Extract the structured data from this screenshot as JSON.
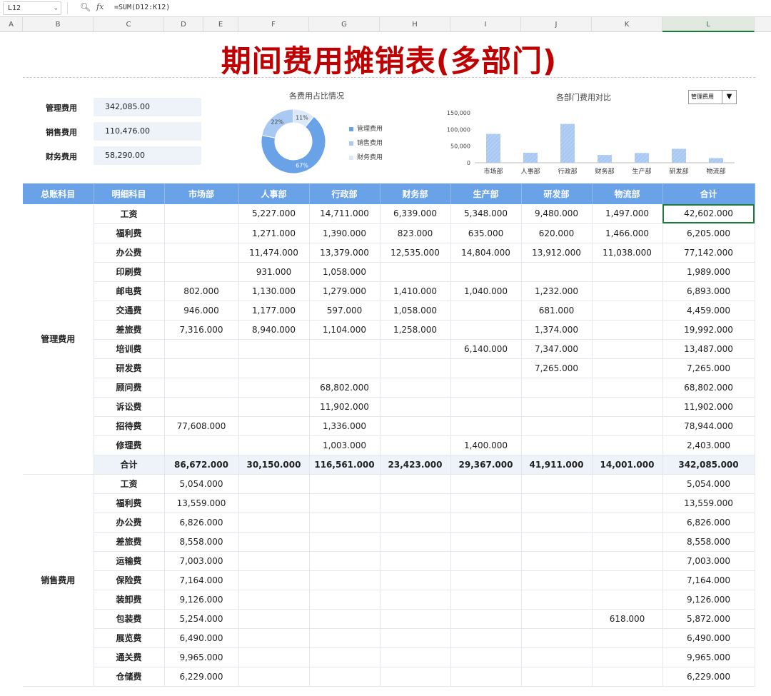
{
  "formula_bar": {
    "cell_ref": "L12",
    "formula": "=SUM(D12:K12)"
  },
  "columns": [
    "A",
    "B",
    "C",
    "D",
    "E",
    "F",
    "G",
    "H",
    "I",
    "J",
    "K",
    "L"
  ],
  "title": "期间费用摊销表(多部门)",
  "summary": [
    {
      "label": "管理费用",
      "value": "342,085.00"
    },
    {
      "label": "销售费用",
      "value": "110,476.00"
    },
    {
      "label": "财务费用",
      "value": "58,290.00"
    }
  ],
  "pie": {
    "title": "各费用占比情况",
    "slices": [
      {
        "name": "管理费用",
        "value": 67,
        "label": "67%",
        "color": "#6aa2e8"
      },
      {
        "name": "销售费用",
        "value": 22,
        "label": "22%",
        "color": "#a9c9f2"
      },
      {
        "name": "财务费用",
        "value": 11,
        "label": "11%",
        "color": "#dbe8f9"
      }
    ]
  },
  "chart_data": {
    "type": "bar",
    "title": "各部门费用对比",
    "categories": [
      "市场部",
      "人事部",
      "行政部",
      "财务部",
      "生产部",
      "研发部",
      "物流部"
    ],
    "values": [
      86672,
      30150,
      116561,
      23423,
      29367,
      41911,
      14001
    ],
    "yticks": [
      "0",
      "50,000",
      "100,000",
      "150,000"
    ],
    "ylim": [
      0,
      150000
    ],
    "color": "#a9c9f2",
    "selector": "管理费用"
  },
  "table": {
    "headers": [
      "总账科目",
      "明细科目",
      "市场部",
      "人事部",
      "行政部",
      "财务部",
      "生产部",
      "研发部",
      "物流部",
      "合计"
    ],
    "groups": [
      {
        "category": "管理费用",
        "rows": [
          [
            "工资",
            "",
            "5,227.000",
            "14,711.000",
            "6,339.000",
            "5,348.000",
            "9,480.000",
            "1,497.000",
            "42,602.000"
          ],
          [
            "福利费",
            "",
            "1,271.000",
            "1,390.000",
            "823.000",
            "635.000",
            "620.000",
            "1,466.000",
            "6,205.000"
          ],
          [
            "办公费",
            "",
            "11,474.000",
            "13,379.000",
            "12,535.000",
            "14,804.000",
            "13,912.000",
            "11,038.000",
            "77,142.000"
          ],
          [
            "印刷费",
            "",
            "931.000",
            "1,058.000",
            "",
            "",
            "",
            "",
            "1,989.000"
          ],
          [
            "邮电费",
            "802.000",
            "1,130.000",
            "1,279.000",
            "1,410.000",
            "1,040.000",
            "1,232.000",
            "",
            "6,893.000"
          ],
          [
            "交通费",
            "946.000",
            "1,177.000",
            "597.000",
            "1,058.000",
            "",
            "681.000",
            "",
            "4,459.000"
          ],
          [
            "差旅费",
            "7,316.000",
            "8,940.000",
            "1,104.000",
            "1,258.000",
            "",
            "1,374.000",
            "",
            "19,992.000"
          ],
          [
            "培训费",
            "",
            "",
            "",
            "",
            "6,140.000",
            "7,347.000",
            "",
            "13,487.000"
          ],
          [
            "研发费",
            "",
            "",
            "",
            "",
            "",
            "7,265.000",
            "",
            "7,265.000"
          ],
          [
            "顾问费",
            "",
            "",
            "68,802.000",
            "",
            "",
            "",
            "",
            "68,802.000"
          ],
          [
            "诉讼费",
            "",
            "",
            "11,902.000",
            "",
            "",
            "",
            "",
            "11,902.000"
          ],
          [
            "招待费",
            "77,608.000",
            "",
            "1,336.000",
            "",
            "",
            "",
            "",
            "78,944.000"
          ],
          [
            "修理费",
            "",
            "",
            "1,003.000",
            "",
            "1,400.000",
            "",
            "",
            "2,403.000"
          ]
        ],
        "subtotal": [
          "合计",
          "86,672.000",
          "30,150.000",
          "116,561.000",
          "23,423.000",
          "29,367.000",
          "41,911.000",
          "14,001.000",
          "342,085.000"
        ]
      },
      {
        "category": "销售费用",
        "rows": [
          [
            "工资",
            "5,054.000",
            "",
            "",
            "",
            "",
            "",
            "",
            "5,054.000"
          ],
          [
            "福利费",
            "13,559.000",
            "",
            "",
            "",
            "",
            "",
            "",
            "13,559.000"
          ],
          [
            "办公费",
            "6,826.000",
            "",
            "",
            "",
            "",
            "",
            "",
            "6,826.000"
          ],
          [
            "差旅费",
            "8,558.000",
            "",
            "",
            "",
            "",
            "",
            "",
            "8,558.000"
          ],
          [
            "运输费",
            "7,003.000",
            "",
            "",
            "",
            "",
            "",
            "",
            "7,003.000"
          ],
          [
            "保险费",
            "7,164.000",
            "",
            "",
            "",
            "",
            "",
            "",
            "7,164.000"
          ],
          [
            "装卸费",
            "9,126.000",
            "",
            "",
            "",
            "",
            "",
            "",
            "9,126.000"
          ],
          [
            "包装费",
            "5,254.000",
            "",
            "",
            "",
            "",
            "",
            "618.000",
            "5,872.000"
          ],
          [
            "展览费",
            "6,490.000",
            "",
            "",
            "",
            "",
            "",
            "",
            "6,490.000"
          ],
          [
            "通关费",
            "9,965.000",
            "",
            "",
            "",
            "",
            "",
            "",
            "9,965.000"
          ],
          [
            "仓储费",
            "6,229.000",
            "",
            "",
            "",
            "",
            "",
            "",
            "6,229.000"
          ]
        ]
      }
    ]
  }
}
